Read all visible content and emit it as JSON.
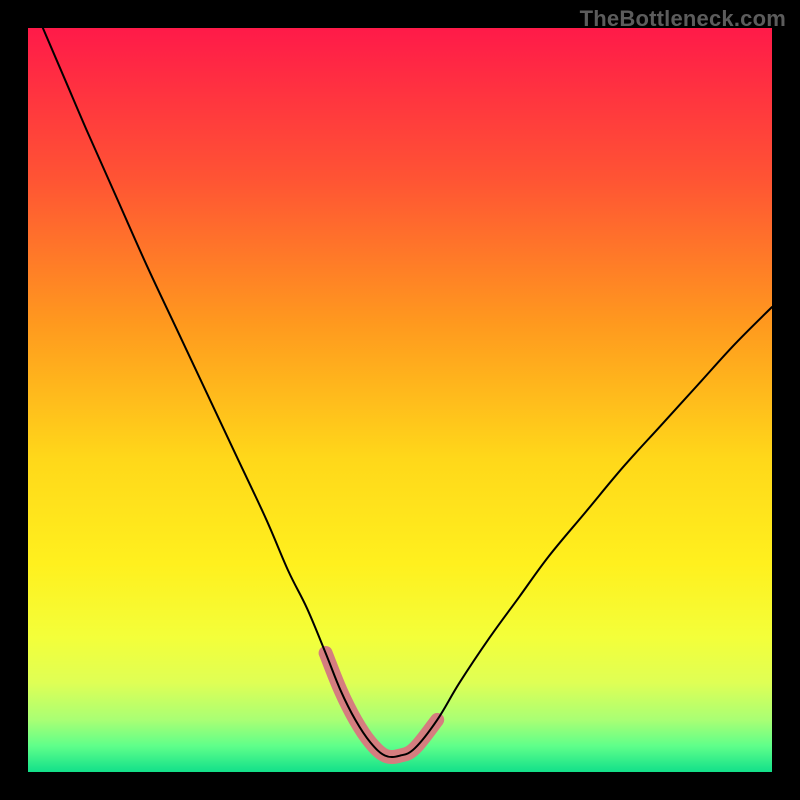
{
  "watermark": {
    "text": "TheBottleneck.com"
  },
  "chart_data": {
    "type": "line",
    "title": "",
    "xlabel": "",
    "ylabel": "",
    "xlim": [
      0,
      100
    ],
    "ylim": [
      0,
      100
    ],
    "grid": false,
    "legend": false,
    "background": {
      "type": "vertical-gradient",
      "stops": [
        {
          "pos": 0.0,
          "color": "#ff1a49"
        },
        {
          "pos": 0.2,
          "color": "#ff5334"
        },
        {
          "pos": 0.4,
          "color": "#ff9a1e"
        },
        {
          "pos": 0.58,
          "color": "#ffd81a"
        },
        {
          "pos": 0.72,
          "color": "#fff01e"
        },
        {
          "pos": 0.82,
          "color": "#f3ff3a"
        },
        {
          "pos": 0.88,
          "color": "#dfff55"
        },
        {
          "pos": 0.93,
          "color": "#a9ff74"
        },
        {
          "pos": 0.965,
          "color": "#5fff8a"
        },
        {
          "pos": 1.0,
          "color": "#12e08a"
        }
      ]
    },
    "series": [
      {
        "name": "bottleneck-curve",
        "color": "#000000",
        "stroke_width": 2,
        "x": [
          2,
          5,
          8,
          12,
          16,
          20,
          24,
          28,
          32,
          35,
          37.5,
          40,
          42,
          44,
          46,
          48,
          50,
          52,
          55,
          58,
          62,
          66,
          70,
          75,
          80,
          85,
          90,
          95,
          100
        ],
        "y": [
          100,
          93,
          86,
          77,
          68,
          59.5,
          51,
          42.5,
          34,
          27,
          22,
          16,
          11,
          7,
          4,
          2.2,
          2.2,
          3.2,
          7,
          12,
          18,
          23.5,
          29,
          35,
          41,
          46.5,
          52,
          57.5,
          62.5
        ]
      },
      {
        "name": "valley-highlight",
        "color": "#d57d7f",
        "stroke_width": 14,
        "linecap": "round",
        "x": [
          40,
          42,
          44,
          46,
          48,
          50,
          52,
          55
        ],
        "y": [
          16,
          11,
          7,
          4,
          2.2,
          2.2,
          3.2,
          7
        ]
      }
    ]
  }
}
